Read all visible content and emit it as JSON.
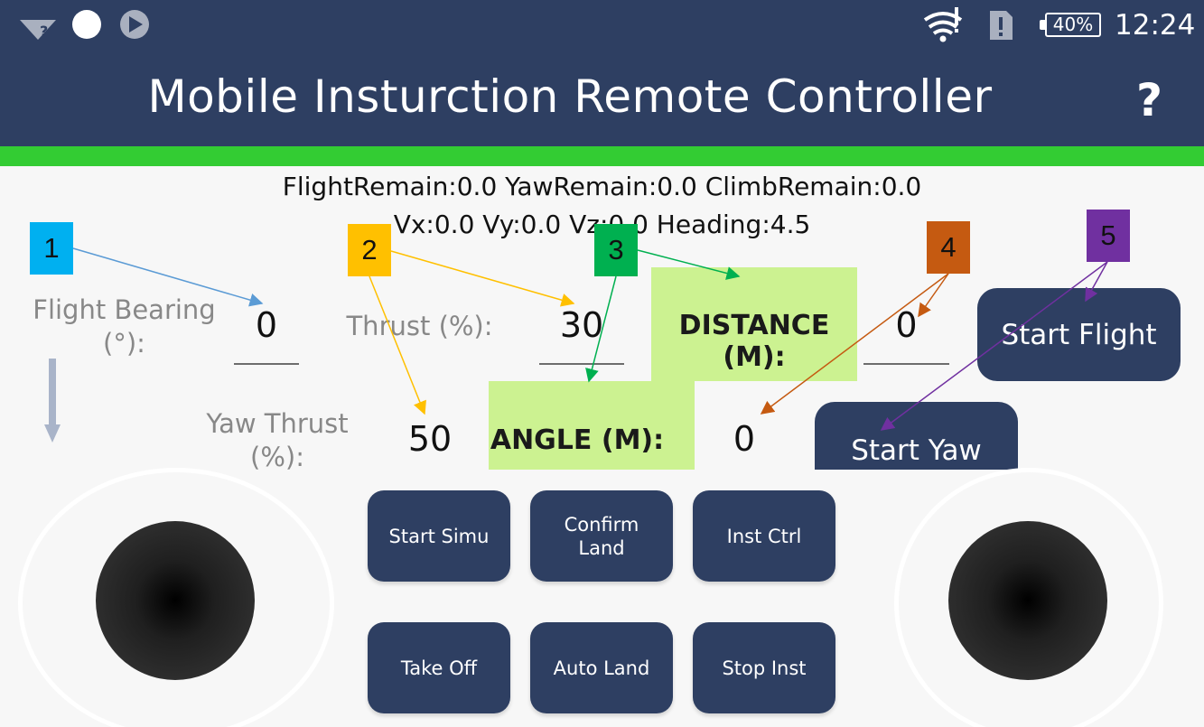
{
  "status_bar": {
    "icons": [
      "wifi-unknown-icon",
      "circle-icon",
      "play-icon",
      "wifi-alert-icon",
      "sim-alert-icon",
      "battery-icon"
    ],
    "battery": "40%",
    "time": "12:24"
  },
  "header": {
    "title": "Mobile Insturction Remote Controller",
    "help": "?"
  },
  "telemetry": {
    "line1": "FlightRemain:0.0 YawRemain:0.0 ClimbRemain:0.0",
    "line2": "Vx:0.0 Vy:0.0 Vz:0.0 Heading:4.5"
  },
  "fields": {
    "flight_bearing_label": "Flight Bearing (°):",
    "flight_bearing_value": "0",
    "thrust_label": "Thrust (%):",
    "thrust_value": "30",
    "distance_label": "DISTANCE (M):",
    "distance_value": "0",
    "yaw_thrust_label": "Yaw Thrust (%):",
    "yaw_thrust_value": "50",
    "angle_label": "ANGLE (M):",
    "angle_value": "0"
  },
  "buttons": {
    "start_flight": "Start Flight",
    "start_yaw": "Start Yaw",
    "start_simu": "Start Simu",
    "confirm_land": "Confirm Land",
    "inst_ctrl": "Inst Ctrl",
    "take_off": "Take Off",
    "auto_land": "Auto Land",
    "stop_inst": "Stop Inst"
  },
  "annotations": [
    {
      "label": "1",
      "color": "#00b0f0"
    },
    {
      "label": "2",
      "color": "#ffc000"
    },
    {
      "label": "3",
      "color": "#00b050"
    },
    {
      "label": "4",
      "color": "#c55a11"
    },
    {
      "label": "5",
      "color": "#7030a0"
    }
  ],
  "colors": {
    "header": "#2e3f62",
    "accent_bar": "#33cc33",
    "highlight_box": "#ccf291",
    "button": "#2e3f62"
  }
}
